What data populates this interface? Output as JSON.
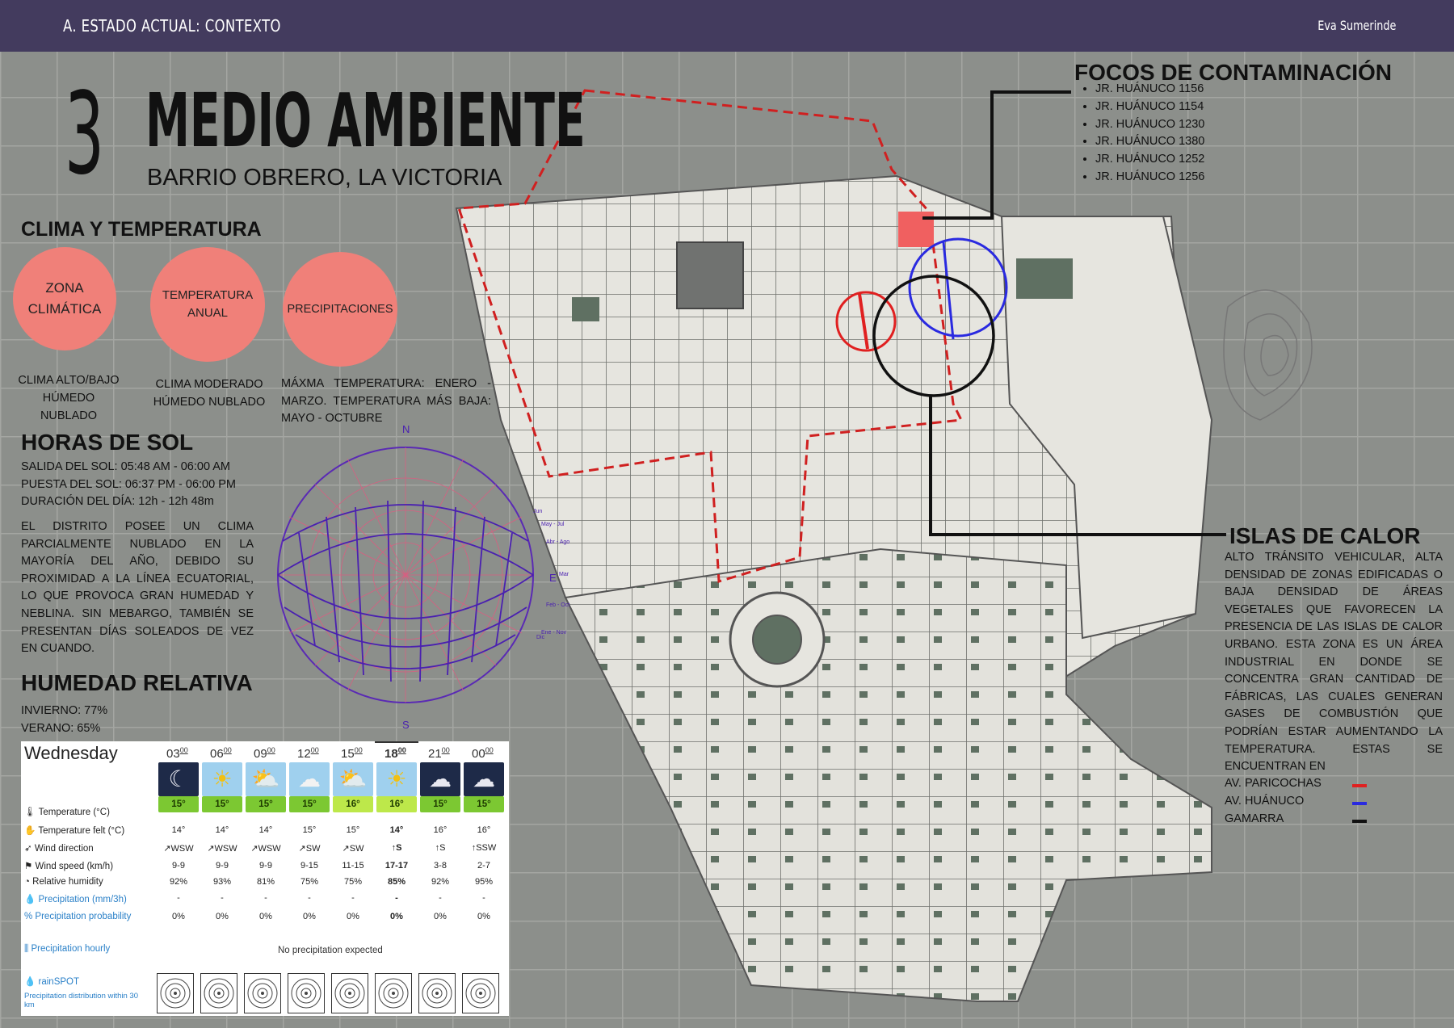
{
  "header": {
    "section": "A. ESTADO ACTUAL: CONTEXTO",
    "author": "Eva Sumerinde"
  },
  "title": {
    "number": "3",
    "main": "MEDIO AMBIENTE",
    "subtitle": "BARRIO OBRERO, LA VICTORIA"
  },
  "clima": {
    "heading": "CLIMA Y TEMPERATURA",
    "circles": [
      {
        "label": "ZONA CLIMÁTICA",
        "description": "CLIMA ALTO/BAJO HÚMEDO NUBLADO"
      },
      {
        "label": "TEMPERATURA ANUAL",
        "description": "CLIMA MODERADO HÚMEDO NUBLADO"
      },
      {
        "label": "PRECIPITACIONES",
        "description": "MÁXMA TEMPERATURA: ENERO - MARZO. TEMPERATURA MÁS BAJA: MAYO - OCTUBRE"
      }
    ],
    "color": "#f08079"
  },
  "horas_sol": {
    "heading": "HORAS DE SOL",
    "salida": "SALIDA DEL SOL: 05:48 AM - 06:00  AM",
    "puesta": "PUESTA DEL SOL: 06:37 PM - 06:00 PM",
    "duracion": "DURACIÓN DEL DÍA: 12h - 12h 48m",
    "description": "EL DISTRITO POSEE UN CLIMA PARCIALMENTE NUBLADO EN LA MAYORÍA DEL AÑO, DEBIDO SU PROXIMIDAD A LA LÍNEA ECUATORIAL, LO QUE PROVOCA GRAN HUMEDAD Y NEBLINA. SIN MEBARGO, TAMBIÉN SE PRESENTAN DÍAS SOLEADOS DE VEZ EN CUANDO."
  },
  "sunpath": {
    "north": "N",
    "south": "S",
    "east": "E",
    "months": [
      "Jun",
      "May - Jul",
      "Abr - Ago",
      "Mar",
      "Feb - Oct",
      "Ene - Nov",
      "Dic"
    ]
  },
  "humedad": {
    "heading": "HUMEDAD RELATIVA",
    "invierno": "INVIERNO: 77%",
    "verano": "VERANO: 65%"
  },
  "weather": {
    "day": "Wednesday",
    "hours": [
      "03",
      "06",
      "09",
      "12",
      "15",
      "18",
      "21",
      "00"
    ],
    "hours_sup": "00",
    "icons": [
      "night-moon-icon",
      "sun-icon",
      "sun-cloud-icon",
      "cloud-icon",
      "sun-cloud-icon",
      "sun-icon",
      "night-cloud-icon",
      "night-cloud-icon"
    ],
    "temps": [
      "15°",
      "15°",
      "15°",
      "15°",
      "16°",
      "16°",
      "15°",
      "15°"
    ],
    "felt": [
      "14°",
      "14°",
      "14°",
      "15°",
      "15°",
      "14°",
      "16°",
      "16°"
    ],
    "wind_dir": [
      "↗WSW",
      "↗WSW",
      "↗WSW",
      "↗SW",
      "↗SW",
      "↑S",
      "↑S",
      "↑SSW"
    ],
    "wind_speed": [
      "9-9",
      "9-9",
      "9-9",
      "9-15",
      "11-15",
      "17-17",
      "3-8",
      "2-7"
    ],
    "humidity": [
      "92%",
      "93%",
      "81%",
      "75%",
      "75%",
      "85%",
      "92%",
      "95%"
    ],
    "precip": [
      "-",
      "-",
      "-",
      "-",
      "-",
      "-",
      "-",
      "-"
    ],
    "precip_prob": [
      "0%",
      "0%",
      "0%",
      "0%",
      "0%",
      "0%",
      "0%",
      "0%"
    ],
    "highlight_index": 5,
    "labels": {
      "temperature": "Temperature (°C)",
      "felt": "Temperature felt (°C)",
      "wind_dir": "Wind direction",
      "wind_speed": "Wind speed (km/h)",
      "humidity": "Relative humidity",
      "precip": "Precipitation (mm/3h)",
      "precip_prob": "Precipitation probability",
      "precip_hourly": "Precipitation hourly",
      "rainspot": "rainSPOT",
      "rainspot_sub": "Precipitation distribution within 30 km"
    },
    "no_precip": "No precipitation expected"
  },
  "focos": {
    "heading": "FOCOS DE CONTAMINACIÓN",
    "items": [
      "JR. HUÁNUCO 1156",
      "JR. HUÁNUCO 1154",
      "JR. HUÁNUCO 1230",
      "JR. HUÁNUCO 1380",
      "JR. HUÁNUCO 1252",
      "JR. HUÁNUCO 1256"
    ]
  },
  "islas": {
    "heading": "ISLAS DE CALOR",
    "description": "ALTO TRÁNSITO VEHICULAR, ALTA DENSIDAD DE ZONAS EDIFICADAS O BAJA DENSIDAD  DE  ÁREAS VEGETALES QUE FAVORECEN LA PRESENCIA DE LAS ISLAS DE CALOR URBANO. ESTA ZONA ES UN ÁREA INDUSTRIAL EN DONDE SE CONCENTRA GRAN CANTIDAD DE FÁBRICAS, LAS CUALES GENERAN GASES DE COMBUSTIÓN QUE PODRÍAN ESTAR AUMENTANDO LA TEMPERATURA. ESTAS SE ENCUENTRAN EN",
    "legend": [
      {
        "label": "AV. PARICOCHAS",
        "color": "#e02020"
      },
      {
        "label": "AV. HUÁNUCO",
        "color": "#2a2ae0"
      },
      {
        "label": "GAMARRA",
        "color": "#111111"
      }
    ]
  },
  "map_colors": {
    "background": "#8e918d",
    "blocks": "#e6e5df",
    "green": "#5f7062",
    "boundary": "#d02020",
    "pollution": "#f06060"
  }
}
